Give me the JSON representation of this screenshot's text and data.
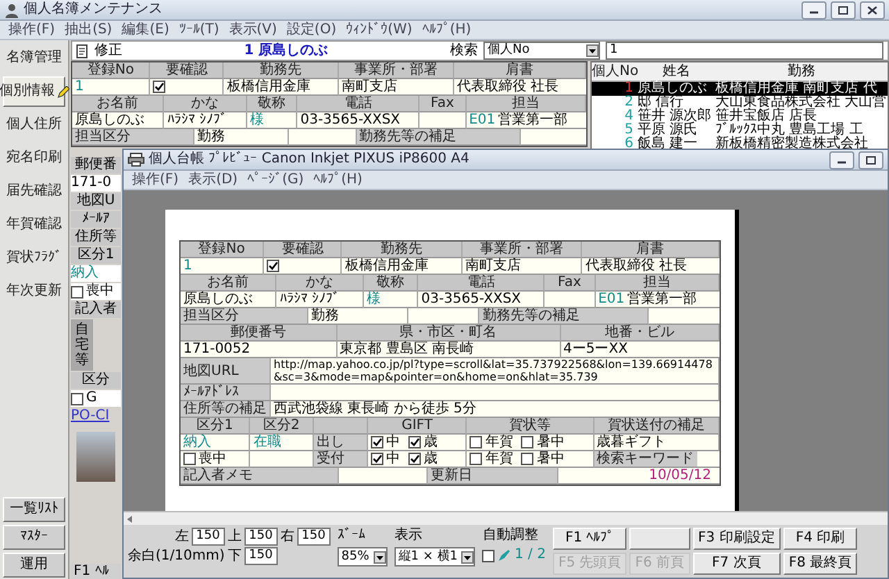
{
  "main_window": {
    "title": "個人名簿メンテナンス",
    "menu": [
      "操作(F)",
      "抽出(S)",
      "編集(E)",
      "ﾂｰﾙ(T)",
      "表示(V)",
      "設定(O)",
      "ｳｨﾝﾄﾞｳ(W)",
      "ﾍﾙﾌﾟ(H)"
    ],
    "sidebar": {
      "top": [
        {
          "label": "名簿管理",
          "selected": false
        },
        {
          "label": "個別情報",
          "selected": true
        },
        {
          "label": "個人住所",
          "selected": false
        },
        {
          "label": "宛名印刷",
          "selected": false
        },
        {
          "label": "届先確認",
          "selected": false
        },
        {
          "label": "年賀確認",
          "selected": false
        },
        {
          "label": "賀状ﾌﾗｸﾞ",
          "selected": false
        },
        {
          "label": "年次更新",
          "selected": false
        }
      ],
      "bottom": [
        "一覧ﾘｽﾄ",
        "ﾏｽﾀｰ",
        "運用"
      ]
    },
    "toolbar": {
      "mode": "修正",
      "record_title": "1 原島しのぶ",
      "search_label": "検索",
      "search_by": "個人No",
      "search_value": "1"
    },
    "form": {
      "rows": [
        {
          "kind": "grid",
          "rows": [
            {
              "cells": [
                {
                  "kind": "head",
                  "text": "登録No"
                },
                {
                  "kind": "head",
                  "text": "要確認"
                },
                {
                  "kind": "head",
                  "text": "勤務先"
                },
                {
                  "kind": "head",
                  "text": "事業所・部署"
                },
                {
                  "kind": "head",
                  "text": "肩書"
                }
              ]
            },
            {
              "cells": [
                {
                  "kind": "code",
                  "text": "1"
                },
                {
                  "kind": "check",
                  "checked": true
                },
                {
                  "kind": "value",
                  "text": "板橋信用金庫"
                },
                {
                  "kind": "value",
                  "text": "南町支店"
                },
                {
                  "kind": "value",
                  "text": "代表取締役 社長"
                }
              ]
            }
          ]
        },
        {
          "kind": "grid",
          "rows": [
            {
              "cells": [
                {
                  "kind": "head",
                  "text": "お名前"
                },
                {
                  "kind": "head",
                  "text": "かな"
                },
                {
                  "kind": "head",
                  "text": "敬称"
                },
                {
                  "kind": "head",
                  "text": "電話"
                },
                {
                  "kind": "head",
                  "text": "Fax"
                },
                {
                  "kind": "head",
                  "text": "担当"
                }
              ]
            },
            {
              "cells": [
                {
                  "kind": "value",
                  "text": "原島しのぶ"
                },
                {
                  "kind": "value",
                  "text": "ﾊﾗｼﾏ ｼﾉﾌﾞ"
                },
                {
                  "kind": "code",
                  "text": "様"
                },
                {
                  "kind": "value",
                  "text": "03-3565-XXSX"
                },
                {
                  "kind": "blank"
                },
                {
                  "kind": "coded",
                  "code": "E01",
                  "text": "営業第一部"
                }
              ]
            }
          ]
        },
        {
          "kind": "grid",
          "rows": [
            {
              "cells": [
                {
                  "kind": "label",
                  "text": "担当区分"
                },
                {
                  "kind": "value",
                  "text": "勤務"
                },
                {
                  "kind": "blank"
                },
                {
                  "kind": "label",
                  "text": "勤務先等の補足"
                },
                {
                  "kind": "blank"
                }
              ]
            }
          ]
        }
      ]
    },
    "person_list": {
      "columns": [
        "個人No",
        "姓名",
        "勤務"
      ],
      "rows": [
        {
          "no": "1",
          "name": "原島しのぶ",
          "company": "板橋信用金庫 南町支店 代",
          "selected": true
        },
        {
          "no": "2",
          "name": "邸 信行",
          "company": "大山東食品株式会社 大山営",
          "selected": false
        },
        {
          "no": "4",
          "name": "笹井 源次郎",
          "company": "笹井宝飯店 店長",
          "selected": false
        },
        {
          "no": "5",
          "name": "平原 源氏",
          "company": "ﾌﾞﾙｯｸｽ中丸 豊島工場 工",
          "selected": false
        },
        {
          "no": "6",
          "name": "飯島 建一",
          "company": "新板橋精密製造株式会社",
          "selected": false
        }
      ]
    },
    "lower_strip": [
      {
        "kind": "label",
        "text": "郵便番"
      },
      {
        "kind": "value",
        "text": "171-0"
      },
      {
        "kind": "label",
        "text": "地図U"
      },
      {
        "kind": "label",
        "text": "ﾒｰﾙｱ"
      },
      {
        "kind": "label",
        "text": "住所等"
      },
      {
        "kind": "label",
        "text": "区分1"
      },
      {
        "kind": "code",
        "text": "納入"
      },
      {
        "kind": "check",
        "text": "喪中",
        "checked": false
      },
      {
        "kind": "label",
        "text": "記入者"
      },
      {
        "kind": "vertical",
        "text": "自宅等"
      },
      {
        "kind": "label",
        "text": "区分"
      },
      {
        "kind": "check",
        "text": "G",
        "checked": false
      },
      {
        "kind": "link",
        "text": "PO-CI"
      },
      {
        "kind": "photo"
      },
      {
        "kind": "status",
        "text": "F1 ﾍﾙ"
      }
    ]
  },
  "preview_window": {
    "title": "個人台帳 ﾌﾟﾚﾋﾞｭｰ Canon Inkjet PIXUS iP8600 A4",
    "menu": [
      "操作(F)",
      "表示(D)",
      "ﾍﾟｰｼﾞ(G)",
      "ﾍﾙﾌﾟ(H)"
    ],
    "record": {
      "rows": [
        {
          "kind": "grid",
          "rows": [
            {
              "cells": [
                {
                  "kind": "head",
                  "text": "登録No"
                },
                {
                  "kind": "head",
                  "text": "要確認"
                },
                {
                  "kind": "head",
                  "text": "勤務先"
                },
                {
                  "kind": "head",
                  "text": "事業所・部署"
                },
                {
                  "kind": "head",
                  "text": "肩書"
                }
              ]
            },
            {
              "cells": [
                {
                  "kind": "code",
                  "text": "1"
                },
                {
                  "kind": "check",
                  "checked": true
                },
                {
                  "kind": "value",
                  "text": "板橋信用金庫"
                },
                {
                  "kind": "value",
                  "text": "南町支店"
                },
                {
                  "kind": "value",
                  "text": "代表取締役 社長"
                }
              ]
            }
          ]
        },
        {
          "kind": "grid",
          "rows": [
            {
              "cells": [
                {
                  "kind": "head",
                  "text": "お名前"
                },
                {
                  "kind": "head",
                  "text": "かな"
                },
                {
                  "kind": "head",
                  "text": "敬称"
                },
                {
                  "kind": "head",
                  "text": "電話"
                },
                {
                  "kind": "head",
                  "text": "Fax"
                },
                {
                  "kind": "head",
                  "text": "担当"
                }
              ]
            },
            {
              "cells": [
                {
                  "kind": "value",
                  "text": "原島しのぶ"
                },
                {
                  "kind": "value",
                  "text": "ﾊﾗｼﾏ ｼﾉﾌﾞ"
                },
                {
                  "kind": "code",
                  "text": "様"
                },
                {
                  "kind": "value",
                  "text": "03-3565-XXSX"
                },
                {
                  "kind": "blank"
                },
                {
                  "kind": "coded",
                  "code": "E01",
                  "text": "営業第一部"
                }
              ]
            }
          ]
        },
        {
          "kind": "grid",
          "rows": [
            {
              "cells": [
                {
                  "kind": "label",
                  "text": "担当区分"
                },
                {
                  "kind": "value",
                  "text": "勤務"
                },
                {
                  "kind": "blank"
                },
                {
                  "kind": "label",
                  "text": "勤務先等の補足"
                },
                {
                  "kind": "blank"
                }
              ]
            }
          ]
        },
        {
          "kind": "rule"
        },
        {
          "kind": "grid",
          "rows": [
            {
              "cells": [
                {
                  "kind": "head",
                  "text": "郵便番号"
                },
                {
                  "kind": "head",
                  "text": "県・市区・町名"
                },
                {
                  "kind": "head",
                  "text": "地番・ビル"
                }
              ]
            },
            {
              "cells": [
                {
                  "kind": "value",
                  "text": "171-0052"
                },
                {
                  "kind": "value",
                  "text": "東京都 豊島区 南長崎"
                },
                {
                  "kind": "value",
                  "text": "4ー5ーXX"
                }
              ]
            }
          ]
        },
        {
          "kind": "grid",
          "rows": [
            {
              "cells": [
                {
                  "kind": "label",
                  "text": "地図URL"
                },
                {
                  "kind": "link",
                  "text": "http://map.yahoo.co.jp/pl?type=scroll&lat=35.737922568&lon=139.66914478&sc=3&mode=map&pointer=on&home=on&hlat=35.739"
                }
              ]
            },
            {
              "cells": [
                {
                  "kind": "label",
                  "text": "ﾒｰﾙｱﾄﾞﾚｽ"
                },
                {
                  "kind": "blank"
                }
              ]
            },
            {
              "cells": [
                {
                  "kind": "label",
                  "text": "住所等の補足"
                },
                {
                  "kind": "value",
                  "text": "西武池袋線 東長崎 から徒歩 5分"
                }
              ]
            }
          ]
        },
        {
          "kind": "rule"
        },
        {
          "kind": "grid",
          "rows": [
            {
              "cells": [
                {
                  "kind": "head",
                  "text": "区分1"
                },
                {
                  "kind": "head",
                  "text": "区分2"
                },
                {
                  "kind": "headblank"
                },
                {
                  "kind": "head",
                  "text": "GIFT"
                },
                {
                  "kind": "head",
                  "text": "賀状等"
                },
                {
                  "kind": "head",
                  "text": "賀状送付の補足"
                }
              ]
            },
            {
              "cells": [
                {
                  "kind": "code",
                  "text": "納入"
                },
                {
                  "kind": "code",
                  "text": "在職"
                },
                {
                  "kind": "label",
                  "text": "出し"
                },
                {
                  "kind": "checks",
                  "items": [
                    {
                      "text": "中",
                      "checked": true
                    },
                    {
                      "text": "歳",
                      "checked": true
                    }
                  ]
                },
                {
                  "kind": "checks",
                  "items": [
                    {
                      "text": "年賀",
                      "checked": false
                    },
                    {
                      "text": "暑中",
                      "checked": false
                    }
                  ]
                },
                {
                  "kind": "value",
                  "text": "歳暮ギフト"
                }
              ]
            },
            {
              "cells": [
                {
                  "kind": "check",
                  "text": "喪中",
                  "checked": false
                },
                {
                  "kind": "blank"
                },
                {
                  "kind": "label",
                  "text": "受付"
                },
                {
                  "kind": "checks",
                  "items": [
                    {
                      "text": "中",
                      "checked": true
                    },
                    {
                      "text": "歳",
                      "checked": true
                    }
                  ]
                },
                {
                  "kind": "checks",
                  "items": [
                    {
                      "text": "年賀",
                      "checked": false
                    },
                    {
                      "text": "暑中",
                      "checked": false
                    }
                  ]
                },
                {
                  "kind": "label_field",
                  "text": "検索キーワード"
                }
              ]
            }
          ]
        },
        {
          "kind": "rule"
        },
        {
          "kind": "grid",
          "rows": [
            {
              "cells": [
                {
                  "kind": "label",
                  "text": "記入者メモ"
                },
                {
                  "kind": "blank"
                },
                {
                  "kind": "label",
                  "text": "更新日"
                },
                {
                  "kind": "date",
                  "text": "10/05/12"
                }
              ]
            }
          ]
        }
      ]
    },
    "controls": {
      "margins": [
        {
          "label": "左",
          "value": "150"
        },
        {
          "label": "上",
          "value": "150"
        },
        {
          "label": "右",
          "value": "150"
        },
        {
          "label": "下",
          "value": "150"
        }
      ],
      "margin_caption": "余白(1/10mm)",
      "zoom": {
        "label": "ｽﾞｰﾑ",
        "value": "85%"
      },
      "display": {
        "label": "表示",
        "value": "縦1 × 横1"
      },
      "auto_fit": {
        "label": "自動調整",
        "checked": false
      },
      "page": "1 / 2",
      "buttons": [
        {
          "label": "F1 ﾍﾙﾌﾟ",
          "disabled": false
        },
        {
          "disabled": false
        },
        {
          "label": "F3 印刷設定",
          "disabled": false
        },
        {
          "label": "F4 印刷",
          "disabled": false
        },
        {
          "label": "F5 先頭頁",
          "disabled": true
        },
        {
          "label": "F6 前頁",
          "disabled": true
        },
        {
          "label": "F7 次頁",
          "disabled": false
        },
        {
          "label": "F8 最終頁",
          "disabled": false
        }
      ]
    }
  }
}
